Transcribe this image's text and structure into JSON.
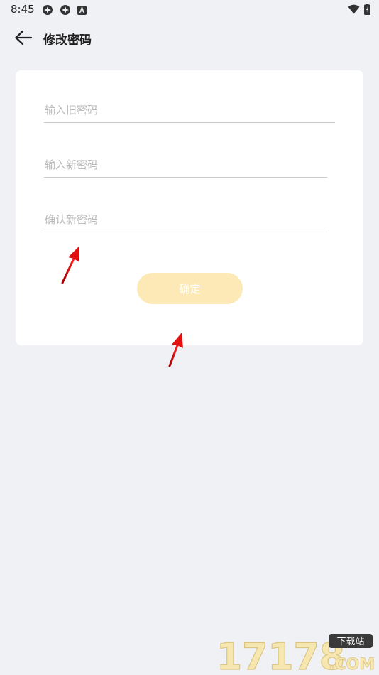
{
  "status_bar": {
    "time": "8:45",
    "left_icons": [
      "notification-icon",
      "notification-icon",
      "a-icon"
    ],
    "right_icons": [
      "wifi-icon",
      "battery-icon"
    ]
  },
  "app_bar": {
    "back_icon": "arrow-left-icon",
    "title": "修改密码"
  },
  "form": {
    "old_password_placeholder": "输入旧密码",
    "new_password_placeholder": "输入新密码",
    "confirm_password_placeholder": "确认新密码",
    "submit_label": "确定"
  },
  "watermark": {
    "number": "17178",
    "badge": "下载站",
    "suffix": ".COM"
  },
  "colors": {
    "background": "#f0f1f5",
    "card": "#ffffff",
    "button": "#fde9b5",
    "annotation_arrow": "#e01010"
  }
}
